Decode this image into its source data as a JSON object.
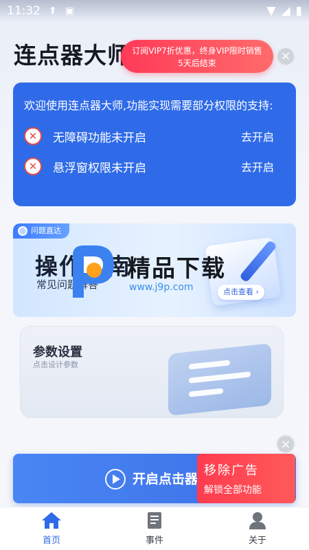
{
  "status_bar": {
    "time": "11:32"
  },
  "app": {
    "title": "连点器大师"
  },
  "promo": {
    "line1": "订阅VIP7折优惠，终身VIP限时销售",
    "line2": "5天后结束"
  },
  "permissions": {
    "intro": "欢迎使用连点器大师,功能实现需要部分权限的支持:",
    "items": [
      {
        "label": "无障碍功能未开启",
        "action": "去开启"
      },
      {
        "label": "悬浮窗权限未开启",
        "action": "去开启"
      }
    ]
  },
  "guide": {
    "tag": "问题直达",
    "title": "操作指南",
    "subtitle": "常见问题解答",
    "button": "点击查看 ›"
  },
  "watermark": {
    "text": "精品下载",
    "url": "www.j9p.com"
  },
  "params": {
    "title": "参数设置",
    "subtitle": "点击设计参数"
  },
  "start": {
    "label": "开启点击器"
  },
  "ad": {
    "title": "移除广告",
    "subtitle": "解锁全部功能"
  },
  "nav": {
    "items": [
      {
        "label": "首页",
        "active": true
      },
      {
        "label": "事件"
      },
      {
        "label": "关于"
      }
    ]
  },
  "colors": {
    "primary": "#2f6be8",
    "promo": "#ff3a58",
    "ad": "#ff3b4f"
  }
}
